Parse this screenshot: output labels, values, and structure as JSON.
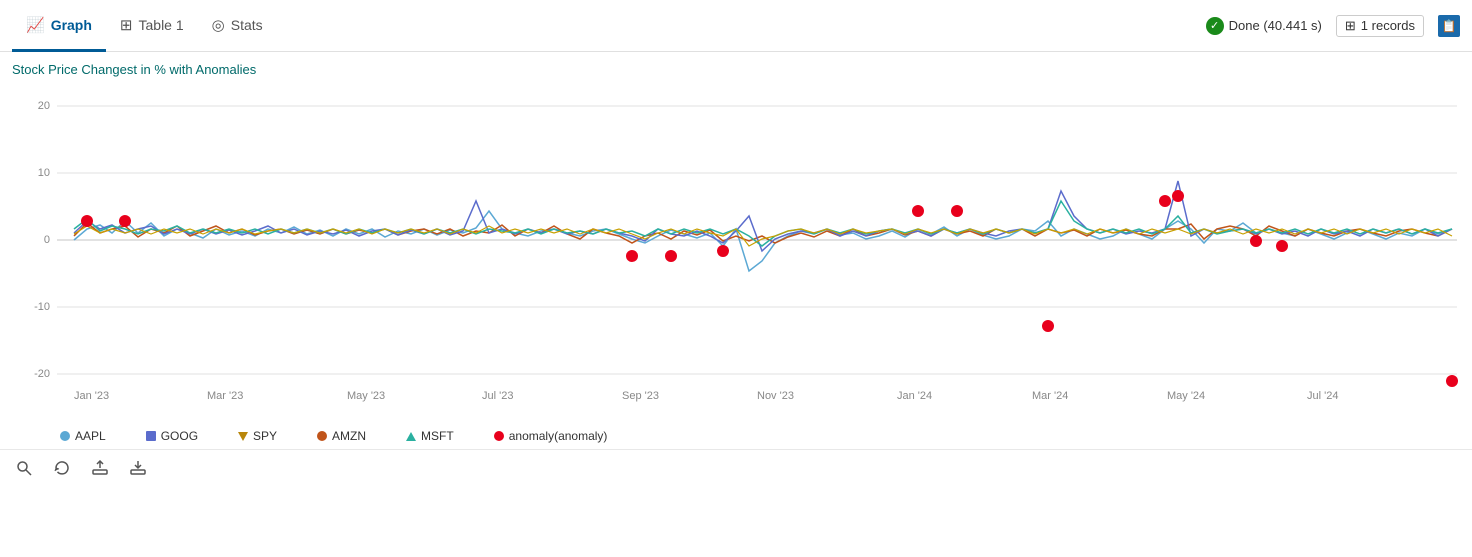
{
  "tabs": [
    {
      "label": "Graph",
      "icon": "📊",
      "active": true
    },
    {
      "label": "Table 1",
      "icon": "⊞",
      "active": false
    },
    {
      "label": "Stats",
      "icon": "◎",
      "active": false
    }
  ],
  "header": {
    "done_label": "Done (40.441 s)",
    "records_label": "1 records"
  },
  "chart": {
    "title": "Stock Price Changest in % with Anomalies",
    "y_axis": [
      20,
      10,
      0,
      -10,
      -20
    ],
    "x_axis": [
      "Jan '23",
      "Mar '23",
      "May '23",
      "Jul '23",
      "Sep '23",
      "Nov '23",
      "Jan '24",
      "Mar '24",
      "May '24",
      "Jul '24"
    ]
  },
  "legend": [
    {
      "label": "AAPL",
      "type": "dot",
      "color": "#5ba8d4"
    },
    {
      "label": "AMZN",
      "type": "dot",
      "color": "#c0541a"
    },
    {
      "label": "GOOG",
      "type": "square",
      "color": "#5b6ccc"
    },
    {
      "label": "MSFT",
      "type": "triangle_up",
      "color": "#2ab0a0"
    },
    {
      "label": "SPY",
      "type": "triangle_down",
      "color": "#b8860b"
    },
    {
      "label": "anomaly(anomaly)",
      "type": "dot",
      "color": "#e8001c"
    }
  ],
  "toolbar": {
    "search_title": "Search",
    "refresh_title": "Refresh",
    "upload_title": "Upload",
    "download_title": "Download"
  }
}
